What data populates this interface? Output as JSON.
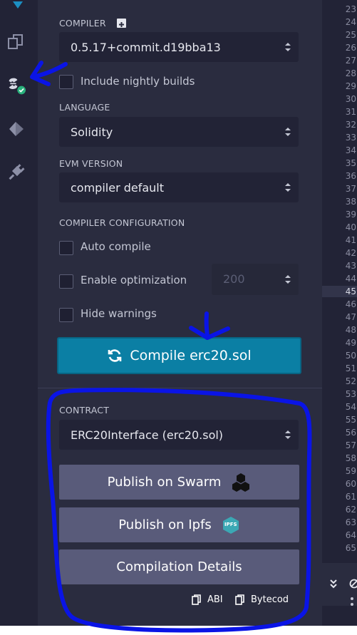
{
  "compiler": {
    "label": "COMPILER",
    "plus_icon": "plus-square-icon",
    "version": "0.5.17+commit.d19bba13",
    "nightly_label": "Include nightly builds"
  },
  "language": {
    "label": "LANGUAGE",
    "value": "Solidity"
  },
  "evm": {
    "label": "EVM VERSION",
    "value": "compiler default"
  },
  "config": {
    "label": "COMPILER CONFIGURATION",
    "auto_compile": "Auto compile",
    "optimization": "Enable optimization",
    "runs": "200",
    "hide_warnings": "Hide warnings"
  },
  "compile_button": "Compile erc20.sol",
  "contract": {
    "label": "CONTRACT",
    "value": "ERC20Interface (erc20.sol)",
    "publish_swarm": "Publish on Swarm",
    "publish_ipfs": "Publish on Ipfs",
    "ipfs_badge": "IPFS",
    "details": "Compilation Details",
    "abi": "ABI",
    "bytecode": "Bytecod"
  },
  "editor": {
    "lines": [
      "23",
      "24",
      "25",
      "26",
      "27",
      "28",
      "29",
      "30",
      "31",
      "32",
      "33",
      "34",
      "35",
      "36",
      "37",
      "38",
      "39",
      "40",
      "41",
      "42",
      "43",
      "44",
      "45",
      "46",
      "47",
      "48",
      "49",
      "50",
      "51",
      "52",
      "53",
      "54",
      "55",
      "56",
      "57",
      "58",
      "59",
      "60",
      "61",
      "62",
      "63",
      "64",
      "65"
    ],
    "active_line": "45"
  },
  "colors": {
    "accent": "#0b7fa4",
    "annotation": "#0a14e6",
    "success": "#29b17c"
  }
}
